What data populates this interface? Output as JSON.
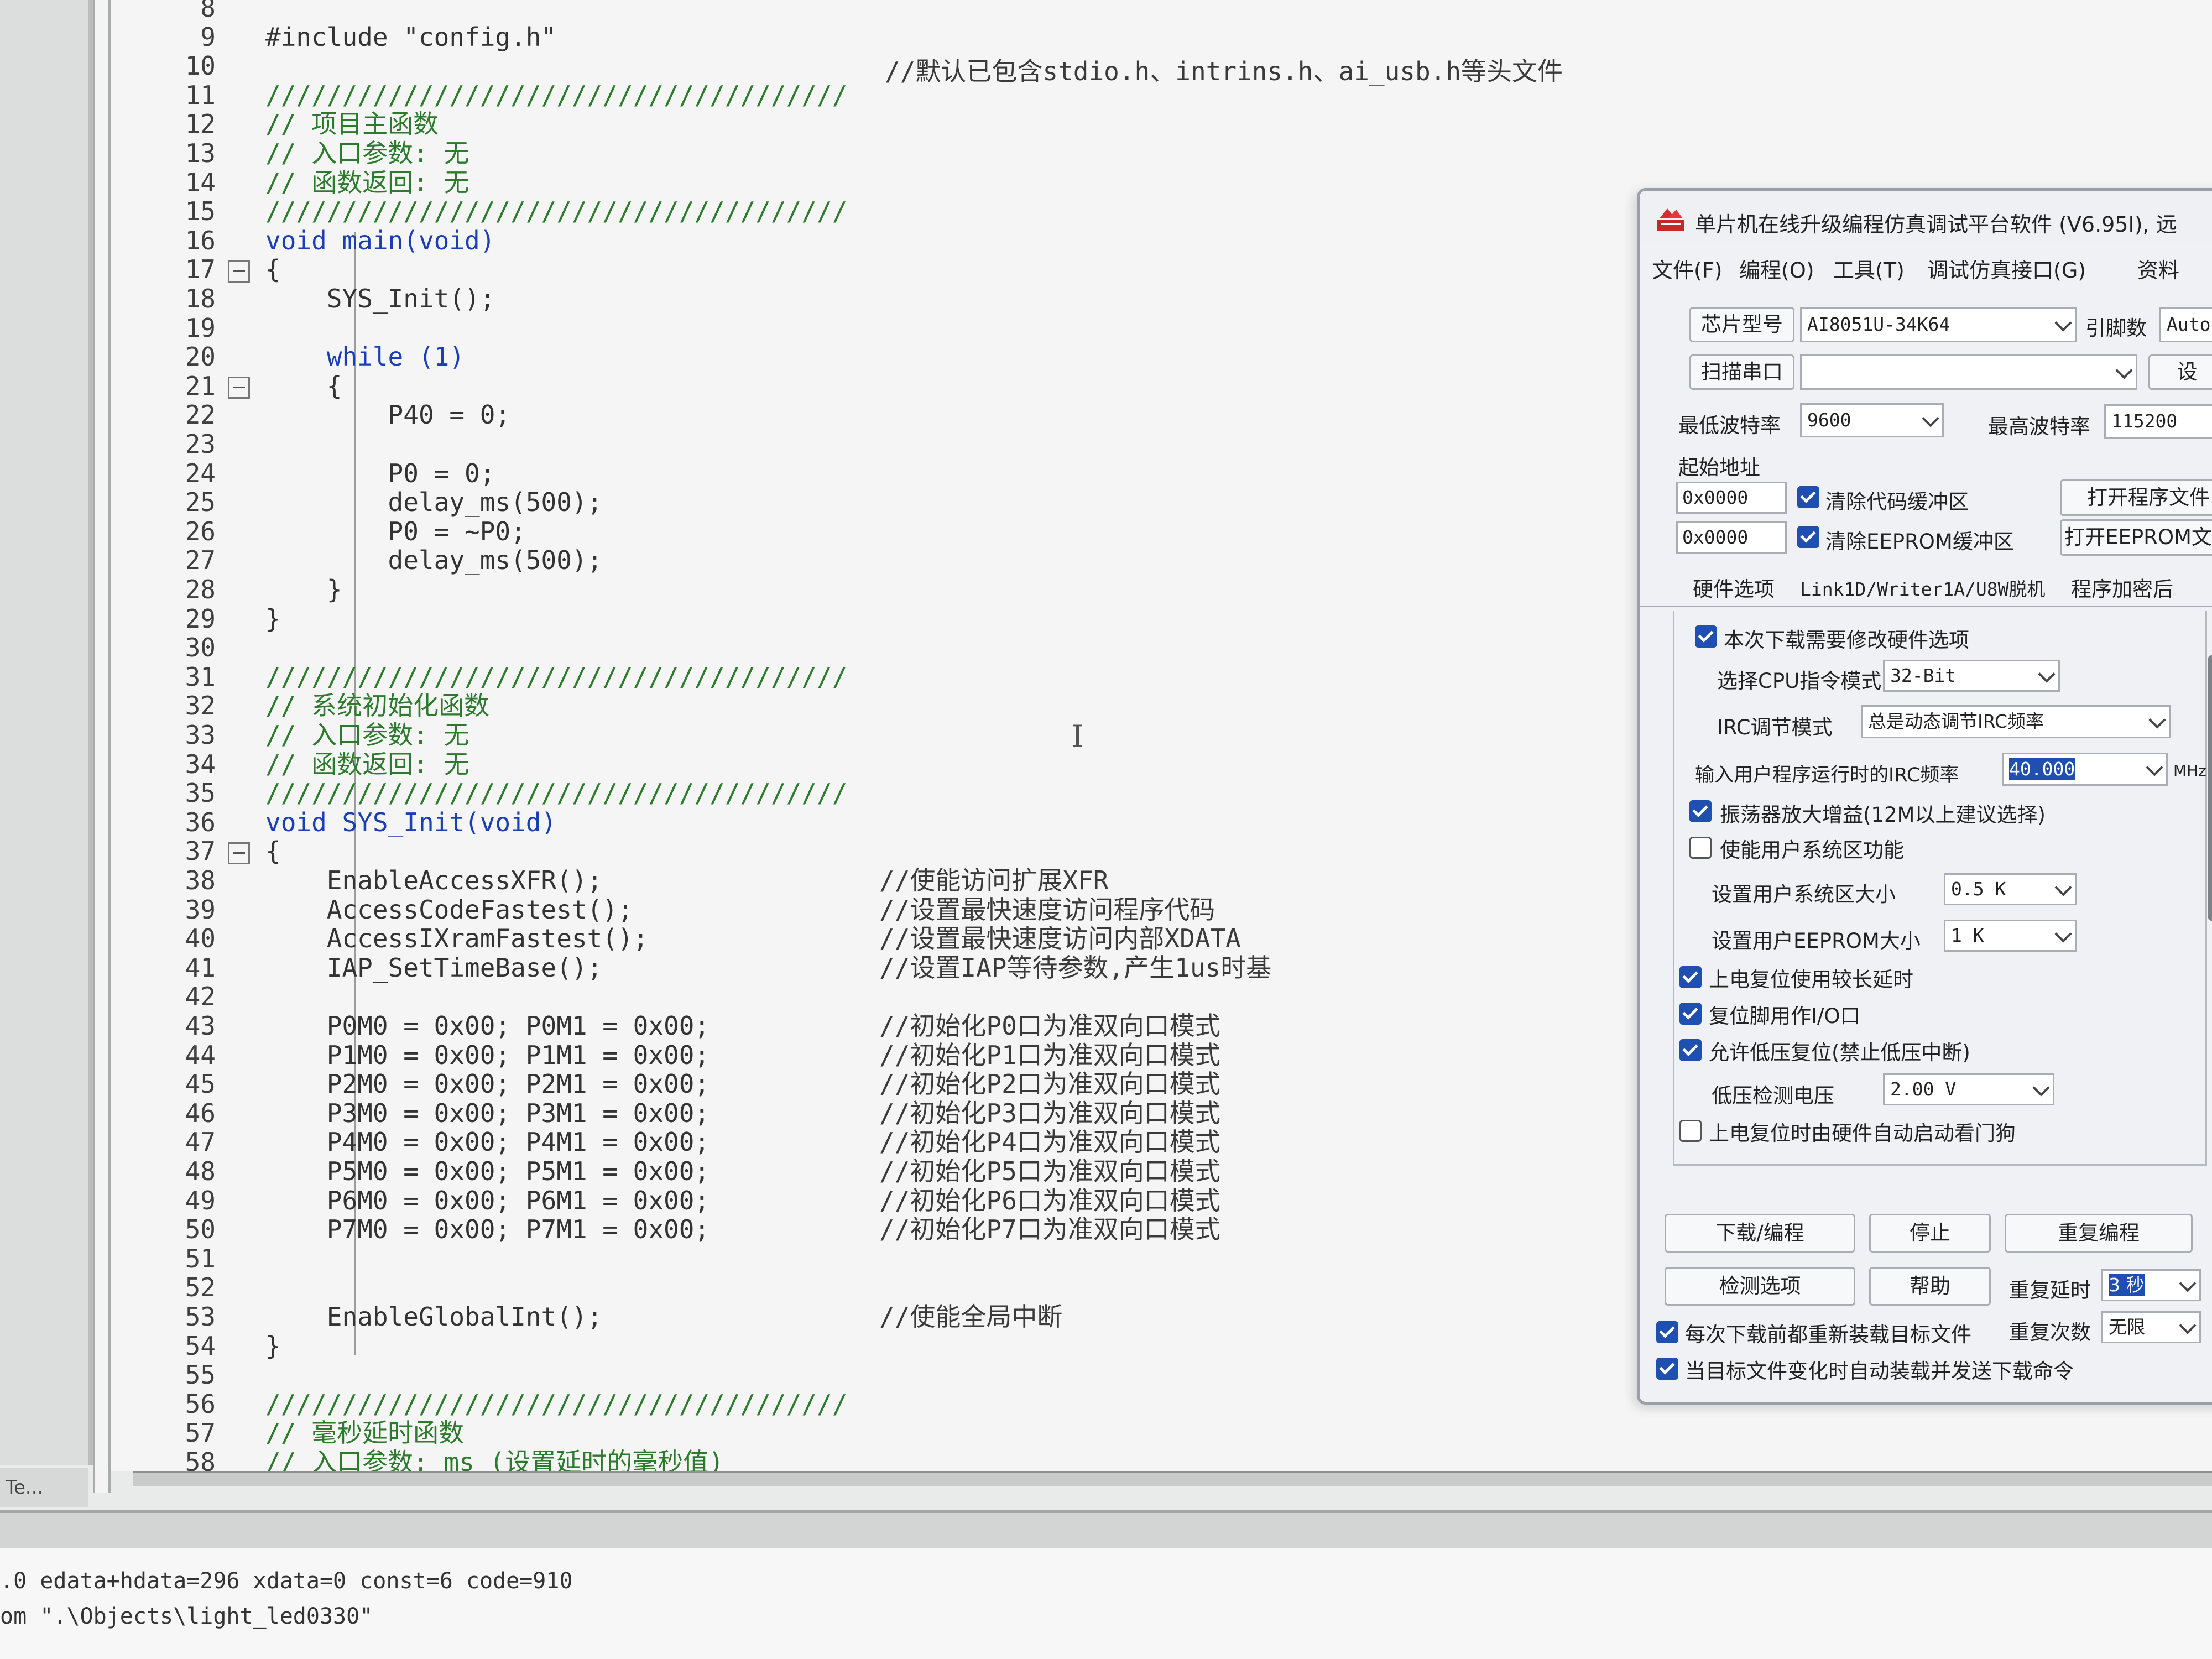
{
  "editor": {
    "lines": [
      {
        "n": "8",
        "text": "",
        "fold": false,
        "kind": "code",
        "comment": ""
      },
      {
        "n": "9",
        "text": "#include \"config.h\"",
        "fold": false,
        "kind": "code",
        "comment": ""
      },
      {
        "n": "10",
        "text": "",
        "fold": false,
        "kind": "code",
        "comment": "//默认已包含stdio.h、intrins.h、ai_usb.h等头文件"
      },
      {
        "n": "11",
        "text": "//////////////////////////////////////",
        "fold": false,
        "kind": "comment",
        "comment": ""
      },
      {
        "n": "12",
        "text": "// 项目主函数",
        "fold": false,
        "kind": "comment",
        "comment": ""
      },
      {
        "n": "13",
        "text": "// 入口参数: 无",
        "fold": false,
        "kind": "comment",
        "comment": ""
      },
      {
        "n": "14",
        "text": "// 函数返回: 无",
        "fold": false,
        "kind": "comment",
        "comment": ""
      },
      {
        "n": "15",
        "text": "//////////////////////////////////////",
        "fold": false,
        "kind": "comment",
        "comment": ""
      },
      {
        "n": "16",
        "text": "void main(void)",
        "fold": false,
        "kind": "kw",
        "comment": ""
      },
      {
        "n": "17",
        "text": "{",
        "fold": true,
        "kind": "code",
        "comment": ""
      },
      {
        "n": "18",
        "text": "    SYS_Init();",
        "fold": false,
        "kind": "code",
        "comment": ""
      },
      {
        "n": "19",
        "text": "",
        "fold": false,
        "kind": "code",
        "comment": ""
      },
      {
        "n": "20",
        "text": "    while (1)",
        "fold": false,
        "kind": "kw",
        "comment": ""
      },
      {
        "n": "21",
        "text": "    {",
        "fold": true,
        "kind": "code",
        "comment": ""
      },
      {
        "n": "22",
        "text": "        P40 = 0;",
        "fold": false,
        "kind": "code",
        "comment": ""
      },
      {
        "n": "23",
        "text": "",
        "fold": false,
        "kind": "code",
        "comment": ""
      },
      {
        "n": "24",
        "text": "        P0 = 0;",
        "fold": false,
        "kind": "code",
        "comment": ""
      },
      {
        "n": "25",
        "text": "        delay_ms(500);",
        "fold": false,
        "kind": "code",
        "comment": ""
      },
      {
        "n": "26",
        "text": "        P0 = ~P0;",
        "fold": false,
        "kind": "code",
        "comment": ""
      },
      {
        "n": "27",
        "text": "        delay_ms(500);",
        "fold": false,
        "kind": "code",
        "comment": ""
      },
      {
        "n": "28",
        "text": "    }",
        "fold": false,
        "kind": "code",
        "comment": ""
      },
      {
        "n": "29",
        "text": "}",
        "fold": false,
        "kind": "code",
        "comment": ""
      },
      {
        "n": "30",
        "text": "",
        "fold": false,
        "kind": "code",
        "comment": ""
      },
      {
        "n": "31",
        "text": "//////////////////////////////////////",
        "fold": false,
        "kind": "comment",
        "comment": ""
      },
      {
        "n": "32",
        "text": "// 系统初始化函数",
        "fold": false,
        "kind": "comment",
        "comment": ""
      },
      {
        "n": "33",
        "text": "// 入口参数: 无",
        "fold": false,
        "kind": "comment",
        "comment": ""
      },
      {
        "n": "34",
        "text": "// 函数返回: 无",
        "fold": false,
        "kind": "comment",
        "comment": ""
      },
      {
        "n": "35",
        "text": "//////////////////////////////////////",
        "fold": false,
        "kind": "comment",
        "comment": ""
      },
      {
        "n": "36",
        "text": "void SYS_Init(void)",
        "fold": false,
        "kind": "kw",
        "comment": ""
      },
      {
        "n": "37",
        "text": "{",
        "fold": true,
        "kind": "code",
        "comment": ""
      },
      {
        "n": "38",
        "text": "    EnableAccessXFR();",
        "fold": false,
        "kind": "code",
        "comment": "//使能访问扩展XFR"
      },
      {
        "n": "39",
        "text": "    AccessCodeFastest();",
        "fold": false,
        "kind": "code",
        "comment": "//设置最快速度访问程序代码"
      },
      {
        "n": "40",
        "text": "    AccessIXramFastest();",
        "fold": false,
        "kind": "code",
        "comment": "//设置最快速度访问内部XDATA"
      },
      {
        "n": "41",
        "text": "    IAP_SetTimeBase();",
        "fold": false,
        "kind": "code",
        "comment": "//设置IAP等待参数,产生1us时基"
      },
      {
        "n": "42",
        "text": "",
        "fold": false,
        "kind": "code",
        "comment": ""
      },
      {
        "n": "43",
        "text": "    P0M0 = 0x00; P0M1 = 0x00;",
        "fold": false,
        "kind": "code",
        "comment": "//初始化P0口为准双向口模式"
      },
      {
        "n": "44",
        "text": "    P1M0 = 0x00; P1M1 = 0x00;",
        "fold": false,
        "kind": "code",
        "comment": "//初始化P1口为准双向口模式"
      },
      {
        "n": "45",
        "text": "    P2M0 = 0x00; P2M1 = 0x00;",
        "fold": false,
        "kind": "code",
        "comment": "//初始化P2口为准双向口模式"
      },
      {
        "n": "46",
        "text": "    P3M0 = 0x00; P3M1 = 0x00;",
        "fold": false,
        "kind": "code",
        "comment": "//初始化P3口为准双向口模式"
      },
      {
        "n": "47",
        "text": "    P4M0 = 0x00; P4M1 = 0x00;",
        "fold": false,
        "kind": "code",
        "comment": "//初始化P4口为准双向口模式"
      },
      {
        "n": "48",
        "text": "    P5M0 = 0x00; P5M1 = 0x00;",
        "fold": false,
        "kind": "code",
        "comment": "//初始化P5口为准双向口模式"
      },
      {
        "n": "49",
        "text": "    P6M0 = 0x00; P6M1 = 0x00;",
        "fold": false,
        "kind": "code",
        "comment": "//初始化P6口为准双向口模式"
      },
      {
        "n": "50",
        "text": "    P7M0 = 0x00; P7M1 = 0x00;",
        "fold": false,
        "kind": "code",
        "comment": "//初始化P7口为准双向口模式"
      },
      {
        "n": "51",
        "text": "",
        "fold": false,
        "kind": "code",
        "comment": ""
      },
      {
        "n": "52",
        "text": "",
        "fold": false,
        "kind": "code",
        "comment": ""
      },
      {
        "n": "53",
        "text": "    EnableGlobalInt();",
        "fold": false,
        "kind": "code",
        "comment": "//使能全局中断"
      },
      {
        "n": "54",
        "text": "}",
        "fold": false,
        "kind": "code",
        "comment": ""
      },
      {
        "n": "55",
        "text": "",
        "fold": false,
        "kind": "code",
        "comment": ""
      },
      {
        "n": "56",
        "text": "//////////////////////////////////////",
        "fold": false,
        "kind": "comment",
        "comment": ""
      },
      {
        "n": "57",
        "text": "// 毫秒延时函数",
        "fold": false,
        "kind": "comment",
        "comment": ""
      },
      {
        "n": "58",
        "text": "// 入口参数: ms (设置延时的毫秒值)",
        "fold": false,
        "kind": "comment",
        "comment": ""
      }
    ]
  },
  "left_tab": {
    "label": "Te..."
  },
  "output": {
    "line1": ".0 edata+hdata=296 xdata=0 const=6 code=910",
    "line2": "om \".\\Objects\\light_led0330\""
  },
  "programmer": {
    "title": "单片机在线升级编程仿真调试平台软件 (V6.95I), 远",
    "menu": [
      "文件(F)",
      "编程(O)",
      "工具(T)",
      "调试仿真接口(G)",
      "资料"
    ],
    "chip_button": "芯片型号",
    "chip_value": "AI8051U-34K64",
    "pins_label": "引脚数",
    "pins_value": "Auto",
    "scan_button": "扫描串口",
    "port_value": "",
    "settings_button": "设",
    "min_baud_label": "最低波特率",
    "min_baud_value": "9600",
    "max_baud_label": "最高波特率",
    "max_baud_value": "115200",
    "start_addr_label": "起始地址",
    "addr1": "0x0000",
    "addr2": "0x0000",
    "clear_code_label": "清除代码缓冲区",
    "clear_eeprom_label": "清除EEPROM缓冲区",
    "open_program_button": "打开程序文件",
    "open_eeprom_button": "打开EEPROM文件",
    "tabs": [
      "硬件选项",
      "Link1D/Writer1A/U8W脱机",
      "程序加密后"
    ],
    "hw": {
      "modify_hw": "本次下载需要修改硬件选项",
      "cpu_mode_label": "选择CPU指令模式",
      "cpu_mode_value": "32-Bit",
      "irc_mode_label": "IRC调节模式",
      "irc_mode_value": "总是动态调节IRC频率",
      "irc_freq_label": "输入用户程序运行时的IRC频率",
      "irc_freq_value": "40.000",
      "irc_unit": "MHz",
      "osc_gain": "振荡器放大增益(12M以上建议选择)",
      "user_sys": "使能用户系统区功能",
      "user_sys_size_label": "设置用户系统区大小",
      "user_sys_size_value": "0.5 K",
      "eeprom_size_label": "设置用户EEPROM大小",
      "eeprom_size_value": "1  K",
      "por_delay": "上电复位使用较长延时",
      "reset_io": "复位脚用作I/O口",
      "lvr": "允许低压复位(禁止低压中断)",
      "lv_label": "低压检测电压",
      "lv_value": "2.00 V",
      "wdt": "上电复位时由硬件自动启动看门狗"
    },
    "download_button": "下载/编程",
    "stop_button": "停止",
    "reprogram_button": "重复编程",
    "check_button": "检测选项",
    "help_button": "帮助",
    "repeat_delay_label": "重复延时",
    "repeat_delay_value": "3 秒",
    "repeat_count_label": "重复次数",
    "repeat_count_value": "无限",
    "reload_each": "每次下载前都重新装载目标文件",
    "auto_reload": "当目标文件变化时自动装载并发送下载命令"
  }
}
